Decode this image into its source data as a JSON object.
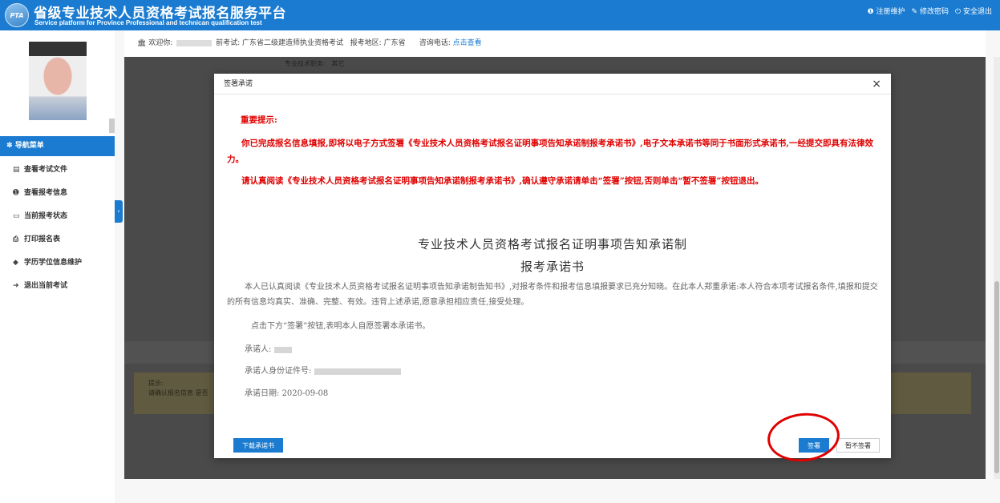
{
  "header": {
    "logo_text": "PTA",
    "title_cn": "省级专业技术人员资格考试报名服务平台",
    "title_en": "Service platform for Province Professional and technican qualification test",
    "links": [
      {
        "icon": "info-circle-icon",
        "glyph": "❶",
        "label": "注册维护"
      },
      {
        "icon": "edit-icon",
        "glyph": "✎",
        "label": "修改密码"
      },
      {
        "icon": "power-icon",
        "glyph": "⏻",
        "label": "安全退出"
      }
    ]
  },
  "infobar": {
    "bank_glyph": "🏛",
    "welcome": "欢迎你:",
    "exam_prefix": "前考试:",
    "exam": "广东省二级建造师执业资格考试",
    "region_label": "报考地区:",
    "region": "广东省",
    "phone_label": "咨询电话:",
    "phone_link": "点击查看"
  },
  "sidebar": {
    "menu_title": "导航菜单",
    "menu_glyph": "✽",
    "items": [
      {
        "icon": "file-icon",
        "glyph": "▤",
        "label": "查看考试文件"
      },
      {
        "icon": "info-icon",
        "glyph": "➊",
        "label": "查看报考信息"
      },
      {
        "icon": "monitor-icon",
        "glyph": "▭",
        "label": "当前报考状态"
      },
      {
        "icon": "print-icon",
        "glyph": "⎙",
        "label": "打印报名表"
      },
      {
        "icon": "graduation-cap-icon",
        "glyph": "◆",
        "label": "学历学位信息维护"
      },
      {
        "icon": "sign-out-icon",
        "glyph": "➜",
        "label": "退出当前考试"
      }
    ]
  },
  "background": {
    "field_label": "专业技术职务:",
    "field_value": "其它",
    "tip_title": "提示:",
    "tip_text": "请确认报名信息 是否"
  },
  "modal": {
    "title": "签署承诺",
    "close": "×",
    "notice_title": "重要提示:",
    "notice_p1": "你已完成报名信息填报,即将以电子方式签署《专业技术人员资格考试报名证明事项告知承诺制报考承诺书》,电子文本承诺书等同于书面形式承诺书,一经提交即具有法律效力。",
    "notice_p2": "请认真阅读《专业技术人员资格考试报名证明事项告知承诺制报考承诺书》,确认遵守承诺请单击“签署”按钮,否则单击“暂不签署”按钮退出。",
    "doc_title": "专业技术人员资格考试报名证明事项告知承诺制",
    "doc_subtitle": "报考承诺书",
    "doc_p1": "本人已认真阅读《专业技术人员资格考试报名证明事项告知承诺制告知书》,对报考条件和报考信息填报要求已充分知晓。在此本人郑重承诺:本人符合本项考试报名条件,填报和提交的所有信息均真实、准确、完整、有效。违背上述承诺,愿意承担相应责任,接受处理。",
    "doc_p2": "点击下方“签署”按钮,表明本人自愿签署本承诺书。",
    "promisor_label": "承诺人:",
    "id_label": "承诺人身份证件号:",
    "date_label": "承诺日期:",
    "date_value": "2020-09-08",
    "download_button": "下载承诺书",
    "sign_button": "签署",
    "decline_button": "暂不签署"
  },
  "colors": {
    "brand_blue": "#1a7bd0",
    "notice_red": "#e00000",
    "overlay_gray": "#4a4a4a"
  }
}
